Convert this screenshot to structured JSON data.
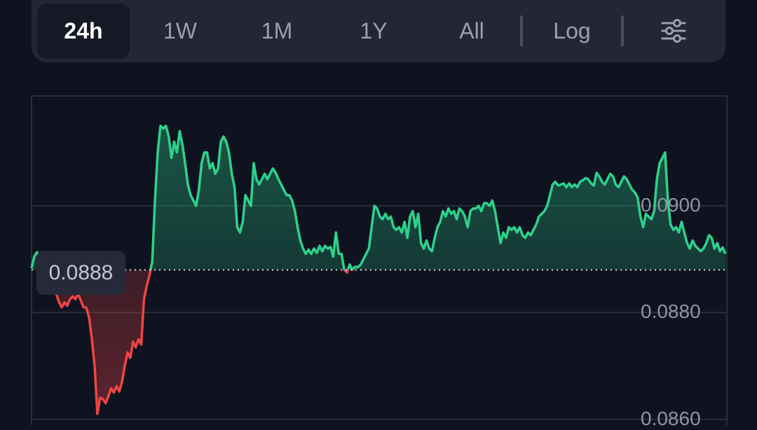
{
  "toolbar": {
    "tabs": [
      {
        "label": "24h",
        "active": true
      },
      {
        "label": "1W",
        "active": false
      },
      {
        "label": "1M",
        "active": false
      },
      {
        "label": "1Y",
        "active": false
      },
      {
        "label": "All",
        "active": false
      }
    ],
    "log_label": "Log",
    "settings_icon": "sliders-icon"
  },
  "colors": {
    "up": "#2ed18b",
    "down": "#ef4444",
    "background": "#0f1320",
    "toolbar": "#232634"
  },
  "chart_data": {
    "type": "area",
    "reference_value": 0.0888,
    "reference_label": "0.0888",
    "y_ticks": [
      {
        "value": 0.09,
        "label": "0.0900"
      },
      {
        "value": 0.088,
        "label": "0.0880"
      },
      {
        "value": 0.086,
        "label": "0.0860"
      }
    ],
    "ylim": [
      0.08589,
      0.09206
    ],
    "grid": true,
    "series": [
      {
        "values": [
          0.08883,
          0.08905,
          0.08913,
          0.08906,
          0.08898,
          0.08902,
          0.08891,
          0.08875,
          0.08862,
          0.08835,
          0.0882,
          0.0881,
          0.08819,
          0.08813,
          0.08825,
          0.0883,
          0.08825,
          0.08835,
          0.08822,
          0.0881,
          0.08809,
          0.0879,
          0.0875,
          0.087,
          0.0861,
          0.0864,
          0.08638,
          0.0863,
          0.08643,
          0.08658,
          0.0865,
          0.08662,
          0.08652,
          0.0867,
          0.087,
          0.08725,
          0.08715,
          0.08745,
          0.08735,
          0.0875,
          0.0874,
          0.08825,
          0.0885,
          0.0887,
          0.08895,
          0.0901,
          0.091,
          0.0915,
          0.09145,
          0.0915,
          0.0913,
          0.0909,
          0.0912,
          0.091,
          0.0914,
          0.09115,
          0.0908,
          0.0904,
          0.0902,
          0.0901,
          0.09,
          0.0903,
          0.0908,
          0.091,
          0.091,
          0.0907,
          0.0908,
          0.0906,
          0.0907,
          0.0912,
          0.0913,
          0.0912,
          0.091,
          0.0906,
          0.09035,
          0.0896,
          0.0895,
          0.0897,
          0.0902,
          0.0901,
          0.09,
          0.0908,
          0.0905,
          0.0904,
          0.0905,
          0.0906,
          0.0905,
          0.0906,
          0.0907,
          0.09062,
          0.0905,
          0.0904,
          0.0903,
          0.0902,
          0.0902,
          0.0901,
          0.0899,
          0.0896,
          0.08935,
          0.0892,
          0.0891,
          0.08918,
          0.0891,
          0.0892,
          0.08912,
          0.08925,
          0.08915,
          0.08925,
          0.0892,
          0.08923,
          0.08905,
          0.0895,
          0.0891,
          0.0891,
          0.0888,
          0.08875,
          0.0889,
          0.0888,
          0.08886,
          0.08885,
          0.0889,
          0.089,
          0.0891,
          0.0892,
          0.0896,
          0.09,
          0.08995,
          0.0898,
          0.08975,
          0.08985,
          0.08975,
          0.0898,
          0.0896,
          0.08955,
          0.0896,
          0.0895,
          0.0897,
          0.0894,
          0.0898,
          0.0899,
          0.0896,
          0.08985,
          0.0893,
          0.0892,
          0.08935,
          0.0892,
          0.08915,
          0.0894,
          0.0896,
          0.0897,
          0.0899,
          0.0898,
          0.08995,
          0.08985,
          0.0899,
          0.08975,
          0.08995,
          0.0899,
          0.0898,
          0.0896,
          0.0899,
          0.08995,
          0.08995,
          0.09,
          0.0899,
          0.09005,
          0.09005,
          0.09,
          0.0901,
          0.0899,
          0.0896,
          0.0893,
          0.0895,
          0.0894,
          0.0896,
          0.08955,
          0.0896,
          0.0895,
          0.0896,
          0.08945,
          0.0894,
          0.0895,
          0.08945,
          0.08955,
          0.08965,
          0.0898,
          0.08985,
          0.0899,
          0.09,
          0.0902,
          0.0904,
          0.09045,
          0.09038,
          0.0904,
          0.09042,
          0.09035,
          0.09042,
          0.09035,
          0.0904,
          0.09035,
          0.09045,
          0.09048,
          0.09052,
          0.0905,
          0.09042,
          0.09038,
          0.09062,
          0.09055,
          0.09045,
          0.0904,
          0.0905,
          0.0906,
          0.09055,
          0.0904,
          0.09035,
          0.09045,
          0.09055,
          0.0905,
          0.0904,
          0.0903,
          0.09025,
          0.09015,
          0.0898,
          0.0896,
          0.08985,
          0.0898,
          0.08975,
          0.0899,
          0.0905,
          0.0908,
          0.0909,
          0.091,
          0.0901,
          0.08965,
          0.08955,
          0.0896,
          0.0895,
          0.0897,
          0.0895,
          0.0893,
          0.0892,
          0.08935,
          0.08925,
          0.0892,
          0.08915,
          0.0892,
          0.0893,
          0.08945,
          0.0894,
          0.0892,
          0.0893,
          0.08915,
          0.08922,
          0.0891
        ]
      }
    ]
  }
}
